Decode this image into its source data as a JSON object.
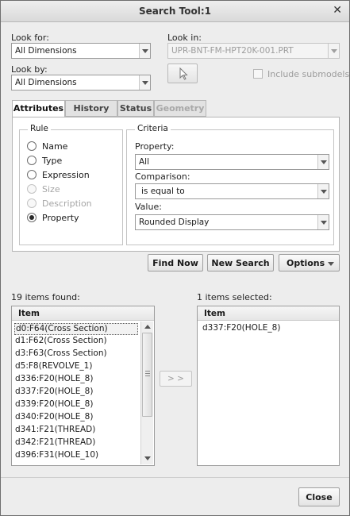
{
  "window": {
    "title": "Search Tool:1",
    "close_glyph": "✕"
  },
  "look_for": {
    "label": "Look for:",
    "value": "All Dimensions"
  },
  "look_by": {
    "label": "Look by:",
    "value": "All Dimensions"
  },
  "look_in": {
    "label": "Look in:",
    "value": "UPR-BNT-FM-HPT20K-001.PRT"
  },
  "pick_button": {
    "icon": "cursor-arrow-icon"
  },
  "include_submodels": {
    "label": "Include submodels",
    "checked": false
  },
  "tabs": [
    {
      "label": "Attributes",
      "active": true
    },
    {
      "label": "History"
    },
    {
      "label": "Status"
    },
    {
      "label": "Geometry",
      "disabled": true
    }
  ],
  "rule": {
    "title": "Rule",
    "options": [
      {
        "label": "Name"
      },
      {
        "label": "Type"
      },
      {
        "label": "Expression"
      },
      {
        "label": "Size",
        "disabled": true
      },
      {
        "label": "Description",
        "disabled": true
      },
      {
        "label": "Property",
        "checked": true
      }
    ]
  },
  "criteria": {
    "title": "Criteria",
    "property_label": "Property:",
    "property_value": "All",
    "comparison_label": "Comparison:",
    "comparison_value": "is equal to",
    "value_label": "Value:",
    "value_value": "Rounded Display"
  },
  "buttons": {
    "find_now": "Find Now",
    "new_search": "New Search",
    "options": "Options",
    "move_right": "> >",
    "close": "Close"
  },
  "found": {
    "label": "19 items found:",
    "column": "Item",
    "items": [
      "d0:F64(Cross Section)",
      "d1:F62(Cross Section)",
      "d3:F63(Cross Section)",
      "d5:F8(REVOLVE_1)",
      "d336:F20(HOLE_8)",
      "d337:F20(HOLE_8)",
      "d339:F20(HOLE_8)",
      "d340:F20(HOLE_8)",
      "d341:F21(THREAD)",
      "d342:F21(THREAD)",
      "d396:F31(HOLE_10)"
    ]
  },
  "selected": {
    "label": "1 items selected:",
    "column": "Item",
    "items": [
      "d337:F20(HOLE_8)"
    ]
  }
}
